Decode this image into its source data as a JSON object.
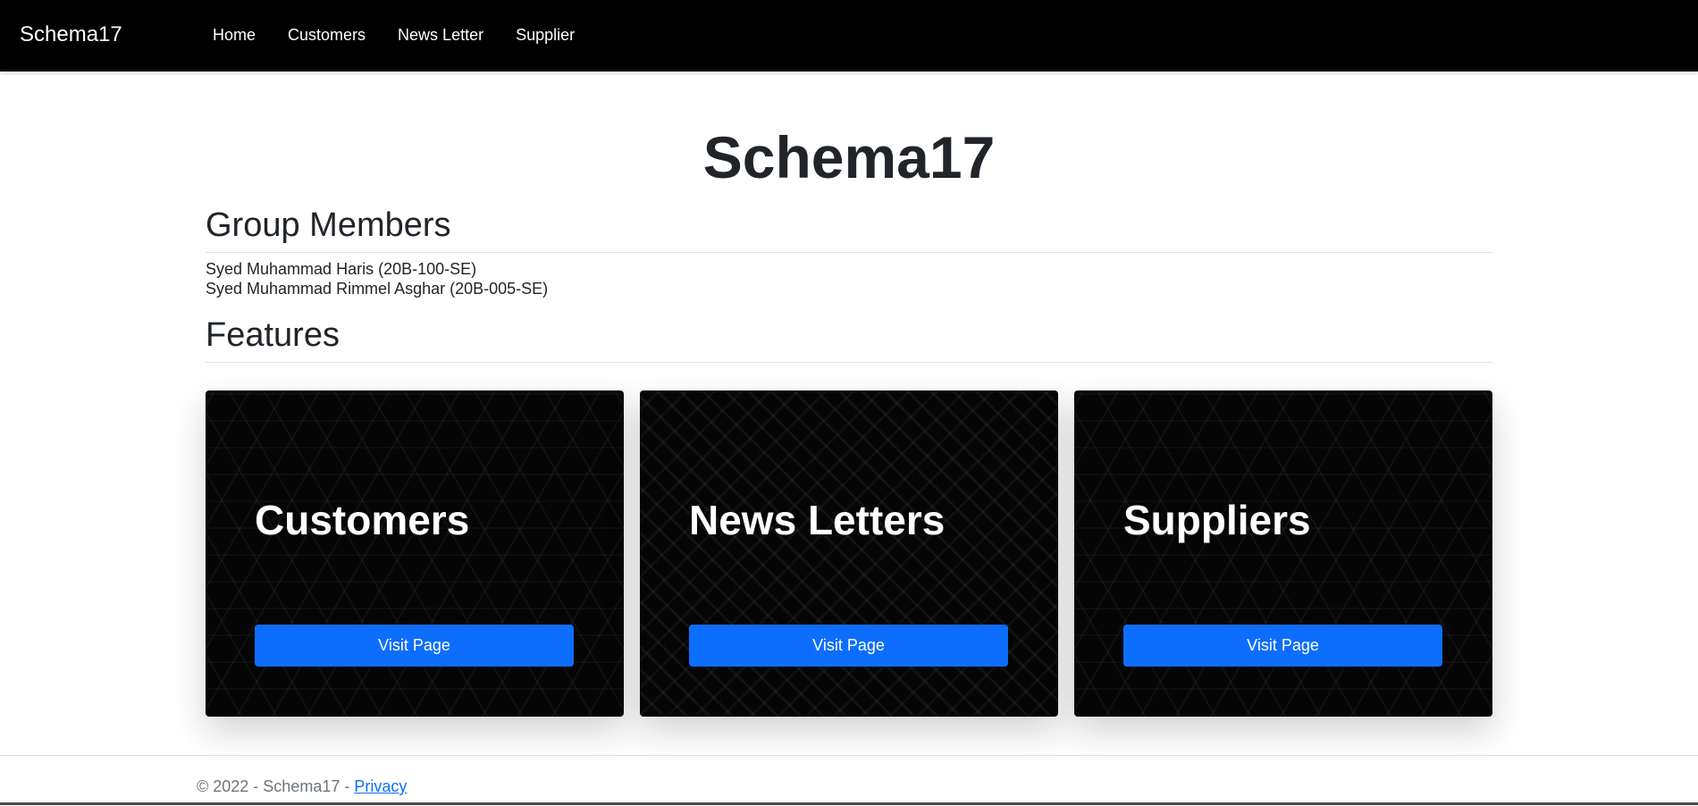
{
  "navbar": {
    "brand": "Schema17",
    "links": [
      "Home",
      "Customers",
      "News Letter",
      "Supplier"
    ]
  },
  "main": {
    "title": "Schema17",
    "group_members_heading": "Group Members",
    "members": [
      "Syed Muhammad Haris (20B-100-SE)",
      "Syed Muhammad Rimmel Asghar (20B-005-SE)"
    ],
    "features_heading": "Features",
    "cards": [
      {
        "title": "Customers",
        "button": "Visit Page"
      },
      {
        "title": "News Letters",
        "button": "Visit Page"
      },
      {
        "title": "Suppliers",
        "button": "Visit Page"
      }
    ]
  },
  "footer": {
    "text": "© 2022 - Schema17 - ",
    "privacy_link": "Privacy"
  },
  "colors": {
    "navbar_bg": "#000000",
    "primary_button": "#0d6efd",
    "card_bg": "#050505"
  }
}
